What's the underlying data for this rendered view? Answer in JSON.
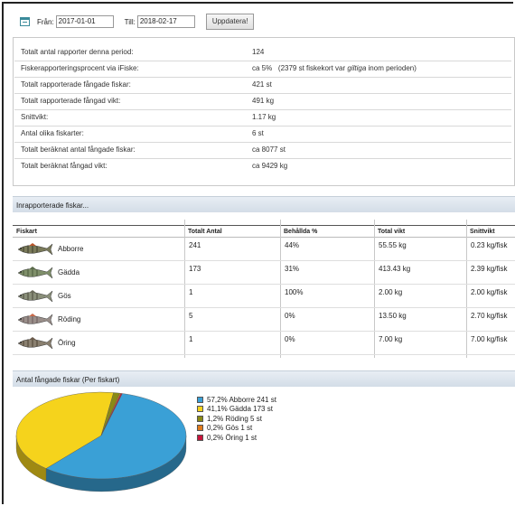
{
  "toolbar": {
    "calendar_icon": "calendar-icon",
    "from_label": "Från:",
    "from_value": "2017-01-01",
    "to_label": "Till:",
    "to_value": "2018-02-17",
    "update_button": "Uppdatera!"
  },
  "stats": [
    {
      "label": "Totalt antal rapporter denna period:",
      "value": "124"
    },
    {
      "label": "Fiskerapporteringsprocent via iFiske:",
      "value": "ca 5%",
      "note": "(2379 st fiskekort var ",
      "note_em": "giltiga",
      "note_end": " inom perioden)"
    },
    {
      "label": "Totalt rapporterade fångade fiskar:",
      "value": "421 st"
    },
    {
      "label": "Totalt rapporterade fångad vikt:",
      "value": "491 kg"
    },
    {
      "label": "Snittvikt:",
      "value": "1.17 kg"
    },
    {
      "label": "Antal olika fiskarter:",
      "value": "6 st"
    },
    {
      "label": "Totalt beräknat antal fångade fiskar:",
      "value": "ca 8077 st"
    },
    {
      "label": "Totalt beräknat fångad vikt:",
      "value": "ca 9429 kg"
    }
  ],
  "reported_section": {
    "title": "Inrapporterade fiskar..."
  },
  "table": {
    "headers": [
      "Fiskart",
      "Totalt Antal",
      "Behållda %",
      "Total vikt",
      "Snittvikt"
    ],
    "rows": [
      {
        "name": "Abborre",
        "count": "241",
        "kept": "44%",
        "weight": "55.55 kg",
        "avg": "0.23 kg/fisk",
        "icon": "perch-fish-icon"
      },
      {
        "name": "Gädda",
        "count": "173",
        "kept": "31%",
        "weight": "413.43 kg",
        "avg": "2.39 kg/fisk",
        "icon": "pike-fish-icon"
      },
      {
        "name": "Gös",
        "count": "1",
        "kept": "100%",
        "weight": "2.00 kg",
        "avg": "2.00 kg/fisk",
        "icon": "zander-fish-icon"
      },
      {
        "name": "Röding",
        "count": "5",
        "kept": "0%",
        "weight": "13.50 kg",
        "avg": "2.70 kg/fisk",
        "icon": "char-fish-icon"
      },
      {
        "name": "Öring",
        "count": "1",
        "kept": "0%",
        "weight": "7.00 kg",
        "avg": "7.00 kg/fisk",
        "icon": "trout-fish-icon"
      }
    ]
  },
  "pie_section": {
    "title": "Antal fångade fiskar (Per fiskart)"
  },
  "chart_data": {
    "type": "pie",
    "slices": [
      {
        "label": "57,2% Abborre 241 st",
        "value": 241,
        "color": "#3aa0d6"
      },
      {
        "label": "41,1% Gädda 173 st",
        "value": 173,
        "color": "#f5d31c"
      },
      {
        "label": "1,2% Röding 5 st",
        "value": 5,
        "color": "#8a8a14"
      },
      {
        "label": "0,2% Gös 1 st",
        "value": 1,
        "color": "#e07a1c"
      },
      {
        "label": "0,2% Öring 1 st",
        "value": 1,
        "color": "#c8143c"
      }
    ]
  }
}
